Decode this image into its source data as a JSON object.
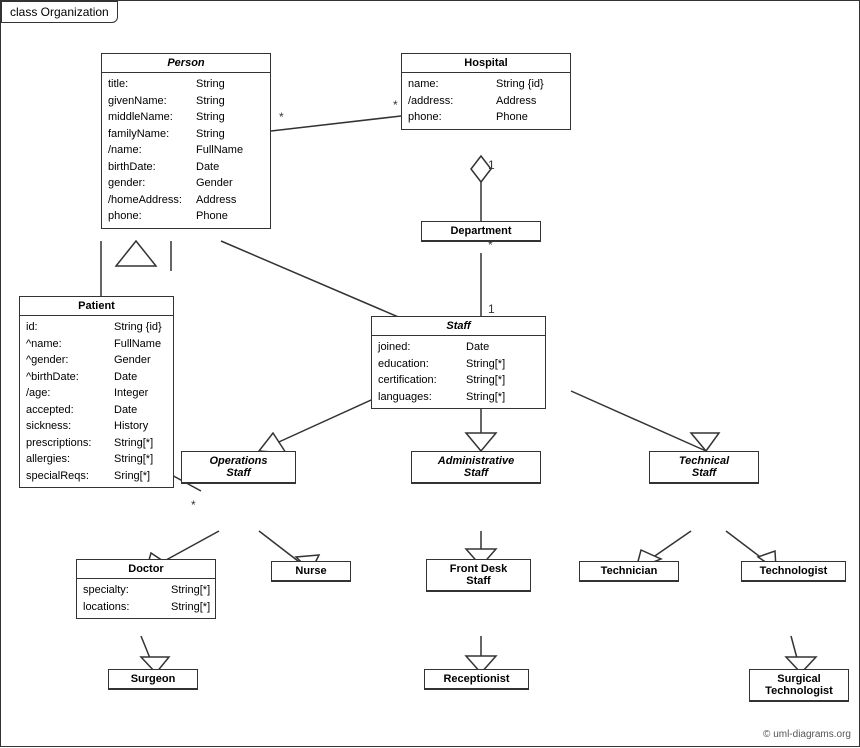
{
  "title": "class Organization",
  "classes": {
    "person": {
      "name": "Person",
      "italic": true,
      "attrs": [
        {
          "name": "title:",
          "type": "String"
        },
        {
          "name": "givenName:",
          "type": "String"
        },
        {
          "name": "middleName:",
          "type": "String"
        },
        {
          "name": "familyName:",
          "type": "String"
        },
        {
          "name": "/name:",
          "type": "FullName"
        },
        {
          "name": "birthDate:",
          "type": "Date"
        },
        {
          "name": "gender:",
          "type": "Gender"
        },
        {
          "name": "/homeAddress:",
          "type": "Address"
        },
        {
          "name": "phone:",
          "type": "Phone"
        }
      ]
    },
    "hospital": {
      "name": "Hospital",
      "italic": false,
      "attrs": [
        {
          "name": "name:",
          "type": "String {id}"
        },
        {
          "name": "/address:",
          "type": "Address"
        },
        {
          "name": "phone:",
          "type": "Phone"
        }
      ]
    },
    "department": {
      "name": "Department",
      "italic": false,
      "attrs": []
    },
    "staff": {
      "name": "Staff",
      "italic": true,
      "attrs": [
        {
          "name": "joined:",
          "type": "Date"
        },
        {
          "name": "education:",
          "type": "String[*]"
        },
        {
          "name": "certification:",
          "type": "String[*]"
        },
        {
          "name": "languages:",
          "type": "String[*]"
        }
      ]
    },
    "patient": {
      "name": "Patient",
      "italic": false,
      "attrs": [
        {
          "name": "id:",
          "type": "String {id}"
        },
        {
          "name": "^name:",
          "type": "FullName"
        },
        {
          "name": "^gender:",
          "type": "Gender"
        },
        {
          "name": "^birthDate:",
          "type": "Date"
        },
        {
          "name": "/age:",
          "type": "Integer"
        },
        {
          "name": "accepted:",
          "type": "Date"
        },
        {
          "name": "sickness:",
          "type": "History"
        },
        {
          "name": "prescriptions:",
          "type": "String[*]"
        },
        {
          "name": "allergies:",
          "type": "String[*]"
        },
        {
          "name": "specialReqs:",
          "type": "Sring[*]"
        }
      ]
    },
    "operations_staff": {
      "name": "Operations Staff",
      "italic": true
    },
    "administrative_staff": {
      "name": "Administrative Staff",
      "italic": true
    },
    "technical_staff": {
      "name": "Technical Staff",
      "italic": true
    },
    "doctor": {
      "name": "Doctor",
      "italic": false,
      "attrs": [
        {
          "name": "specialty:",
          "type": "String[*]"
        },
        {
          "name": "locations:",
          "type": "String[*]"
        }
      ]
    },
    "nurse": {
      "name": "Nurse",
      "italic": false,
      "attrs": []
    },
    "front_desk_staff": {
      "name": "Front Desk Staff",
      "italic": false,
      "attrs": []
    },
    "technician": {
      "name": "Technician",
      "italic": false,
      "attrs": []
    },
    "technologist": {
      "name": "Technologist",
      "italic": false,
      "attrs": []
    },
    "surgeon": {
      "name": "Surgeon",
      "italic": false,
      "attrs": []
    },
    "receptionist": {
      "name": "Receptionist",
      "italic": false,
      "attrs": []
    },
    "surgical_technologist": {
      "name": "Surgical Technologist",
      "italic": false,
      "attrs": []
    }
  },
  "copyright": "© uml-diagrams.org"
}
